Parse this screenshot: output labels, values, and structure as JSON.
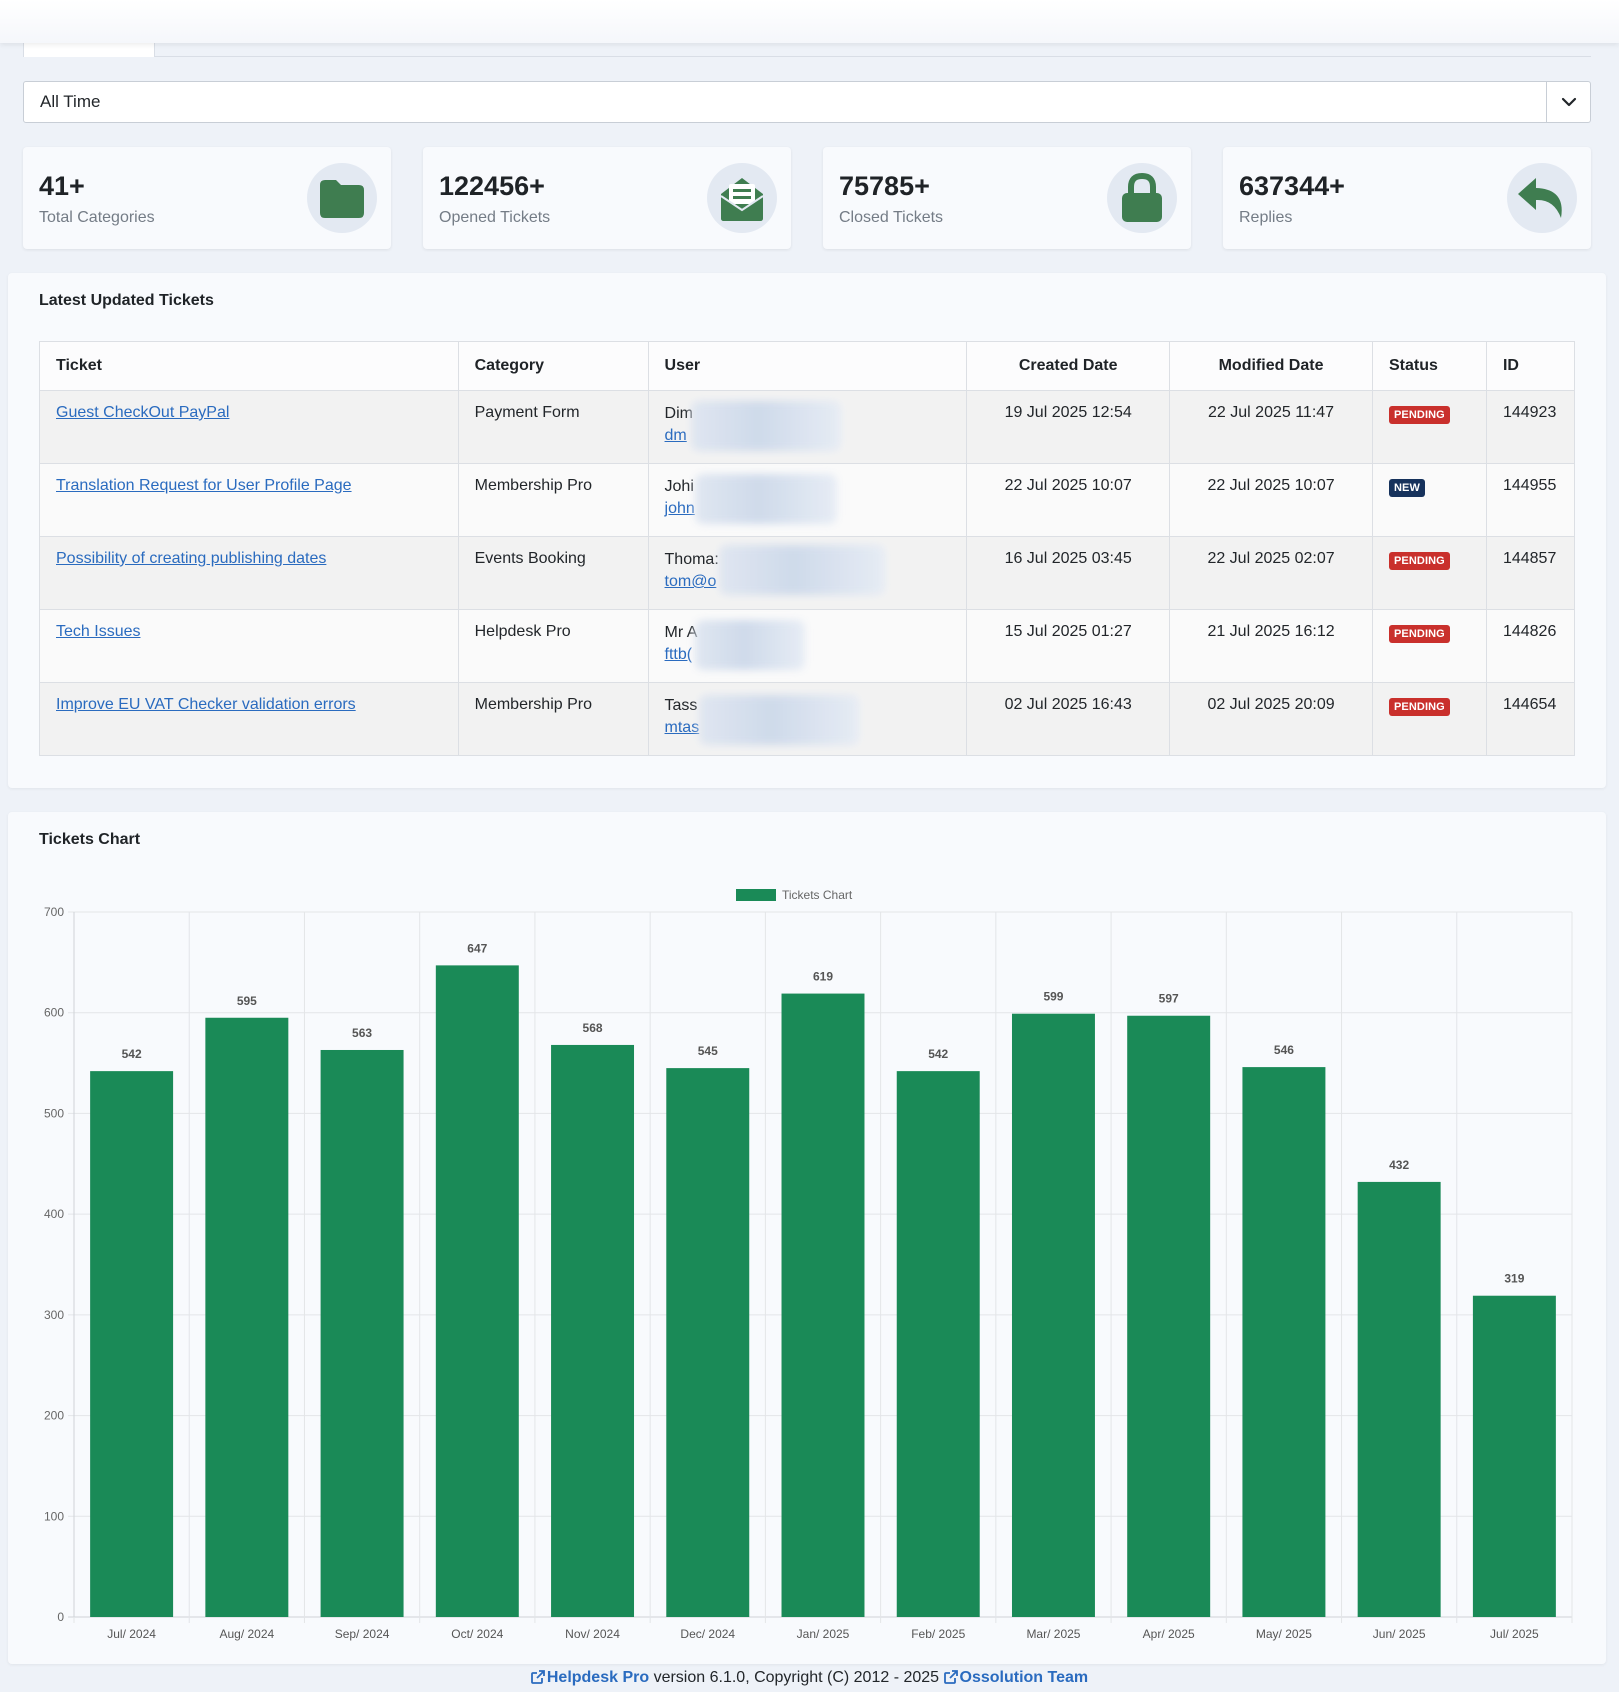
{
  "filter": {
    "selected": "All Time"
  },
  "stats": [
    {
      "value": "41+",
      "label": "Total Categories",
      "icon": "folder-icon"
    },
    {
      "value": "122456+",
      "label": "Opened Tickets",
      "icon": "envelope-open-icon"
    },
    {
      "value": "75785+",
      "label": "Closed Tickets",
      "icon": "lock-icon"
    },
    {
      "value": "637344+",
      "label": "Replies",
      "icon": "reply-icon"
    }
  ],
  "latest": {
    "title": "Latest Updated Tickets",
    "columns": [
      "Ticket",
      "Category",
      "User",
      "Created Date",
      "Modified Date",
      "Status",
      "ID"
    ],
    "rows": [
      {
        "ticket": "Guest CheckOut PayPal",
        "category": "Payment Form",
        "user_name": "Dim",
        "user_email": "dm",
        "created": "19 Jul 2025 12:54",
        "modified": "22 Jul 2025 11:47",
        "status": "PENDING",
        "id": "144923"
      },
      {
        "ticket": "Translation Request for User Profile Page",
        "category": "Membership Pro",
        "user_name": "Johi",
        "user_email": "john",
        "created": "22 Jul 2025 10:07",
        "modified": "22 Jul 2025 10:07",
        "status": "NEW",
        "id": "144955"
      },
      {
        "ticket": "Possibility of creating publishing dates",
        "category": "Events Booking",
        "user_name": "Thoma:",
        "user_email": "tom@o",
        "created": "16 Jul 2025 03:45",
        "modified": "22 Jul 2025 02:07",
        "status": "PENDING",
        "id": "144857"
      },
      {
        "ticket": "Tech Issues",
        "category": "Helpdesk Pro",
        "user_name": "Mr A",
        "user_email": "fttb(",
        "created": "15 Jul 2025 01:27",
        "modified": "21 Jul 2025 16:12",
        "status": "PENDING",
        "id": "144826"
      },
      {
        "ticket": "Improve EU VAT Checker validation errors",
        "category": "Membership Pro",
        "user_name": "Tass",
        "user_email": "mtas",
        "created": "02 Jul 2025 16:43",
        "modified": "02 Jul 2025 20:09",
        "status": "PENDING",
        "id": "144654"
      }
    ]
  },
  "chart_panel": {
    "title": "Tickets Chart"
  },
  "chart_data": {
    "type": "bar",
    "title": "",
    "xlabel": "",
    "ylabel": "",
    "legend": "top-center",
    "grid": true,
    "ylim": [
      0,
      700
    ],
    "yticks": [
      0,
      100,
      200,
      300,
      400,
      500,
      600,
      700
    ],
    "categories": [
      "Jul/ 2024",
      "Aug/ 2024",
      "Sep/ 2024",
      "Oct/ 2024",
      "Nov/ 2024",
      "Dec/ 2024",
      "Jan/ 2025",
      "Feb/ 2025",
      "Mar/ 2025",
      "Apr/ 2025",
      "May/ 2025",
      "Jun/ 2025",
      "Jul/ 2025"
    ],
    "series": [
      {
        "name": "Tickets Chart",
        "color": "#1a8a57",
        "values": [
          542,
          595,
          563,
          647,
          568,
          545,
          619,
          542,
          599,
          597,
          546,
          432,
          319
        ]
      }
    ]
  },
  "footer": {
    "product": "Helpdesk Pro",
    "text": "version 6.1.0, Copyright (C) 2012 - 2025",
    "team": "Ossolution Team"
  },
  "colors": {
    "icon_green": "#3f7d50",
    "bar_green": "#1a8a57",
    "link_blue": "#2a6bbf",
    "pending_red": "#c9302c",
    "new_navy": "#16325c"
  }
}
